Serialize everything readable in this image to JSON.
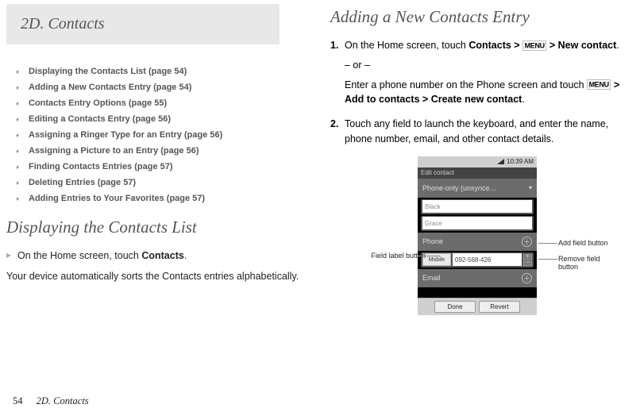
{
  "header": {
    "tab_label": "2D.  Contacts"
  },
  "toc": [
    "Displaying the Contacts List (page 54)",
    "Adding a New Contacts Entry (page 54)",
    "Contacts Entry Options (page 55)",
    "Editing a Contacts Entry (page 56)",
    "Assigning a Ringer Type for an Entry (page 56)",
    "Assigning a Picture to an Entry (page 56)",
    "Finding Contacts Entries (page 57)",
    "Deleting Entries (page 57)",
    "Adding Entries to Your Favorites (page 57)"
  ],
  "left": {
    "h2": "Displaying the Contacts List",
    "arrow_pre": "On the Home screen, touch ",
    "arrow_bold": "Contacts",
    "arrow_post": ".",
    "para": "Your device automatically sorts the Contacts entries alphabetically."
  },
  "right": {
    "h2": "Adding a New Contacts Entry",
    "step1_parts": {
      "pre": "On the Home screen, touch ",
      "b1": "Contacts",
      "gt1": " > ",
      "menu1": "MENU",
      "gt2": " > ",
      "b2": "New contact",
      "end": ".",
      "or": "– or –",
      "p2_pre": "Enter a phone number on the Phone screen and touch ",
      "menu2": "MENU",
      "gt3": " > ",
      "b3": "Add to contacts",
      "gt4": " > ",
      "b4": "Create new contact",
      "end2": "."
    },
    "step2": "Touch any field to launch the keyboard, and enter the name, phone number, email, and other contact details."
  },
  "phone": {
    "time": "10:39 AM",
    "title": "Edit contact",
    "acct": "Phone-only (unsynce…",
    "hint1": "Black",
    "hint2": "Grace",
    "section_phone": "Phone",
    "phone_label": "Mobile",
    "phone_value": "092-568-426",
    "section_email": "Email",
    "done": "Done",
    "revert": "Revert"
  },
  "callouts": {
    "add": "Add field button",
    "remove": "Remove field button",
    "field_label": "Field label button"
  },
  "footer": {
    "page": "54",
    "section": "2D. Contacts"
  }
}
